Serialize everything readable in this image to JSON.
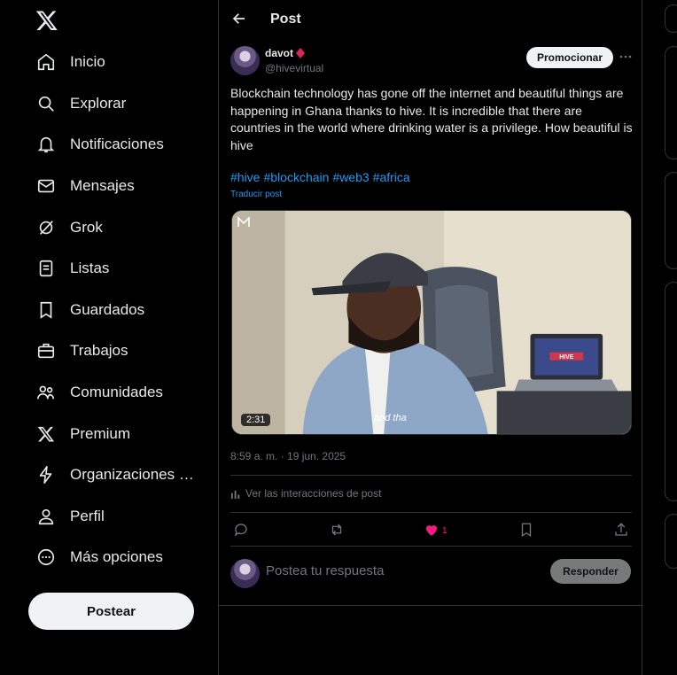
{
  "sidebar": {
    "items": [
      {
        "label": "Inicio",
        "icon": "home-icon"
      },
      {
        "label": "Explorar",
        "icon": "search-icon"
      },
      {
        "label": "Notificaciones",
        "icon": "bell-icon"
      },
      {
        "label": "Mensajes",
        "icon": "mail-icon"
      },
      {
        "label": "Grok",
        "icon": "grok-icon"
      },
      {
        "label": "Listas",
        "icon": "list-icon"
      },
      {
        "label": "Guardados",
        "icon": "bookmark-icon"
      },
      {
        "label": "Trabajos",
        "icon": "briefcase-icon"
      },
      {
        "label": "Comunidades",
        "icon": "people-icon"
      },
      {
        "label": "Premium",
        "icon": "x-logo-icon"
      },
      {
        "label": "Organizaciones v...",
        "icon": "lightning-icon"
      },
      {
        "label": "Perfil",
        "icon": "person-icon"
      },
      {
        "label": "Más opciones",
        "icon": "more-circle-icon"
      }
    ],
    "post_button": "Postear"
  },
  "header": {
    "title": "Post"
  },
  "post": {
    "author_name": "davot",
    "author_handle": "@hivevirtual",
    "promote_label": "Promocionar",
    "text": "Blockchain technology has gone off the internet and beautiful things are happening in Ghana thanks to hive. It is incredible that there are countries in the world where drinking water is a privilege. How beautiful is hive",
    "hashtags": [
      "#hive",
      "#blockchain",
      "#web3",
      "#africa"
    ],
    "translate_label": "Traducir post",
    "video_duration": "2:31",
    "video_subtitle": "and tha",
    "laptop_brand": "HIVE",
    "timestamp": "8:59 a. m. · 19 jun. 2025",
    "interactions_label": "Ver las interacciones de post",
    "like_count": "1"
  },
  "reply": {
    "placeholder": "Postea tu respuesta",
    "button_label": "Responder"
  },
  "colors": {
    "accent": "#1d9bf0",
    "like": "#f91880",
    "background": "#000000",
    "text": "#e7e9ea",
    "muted": "#71767b"
  }
}
